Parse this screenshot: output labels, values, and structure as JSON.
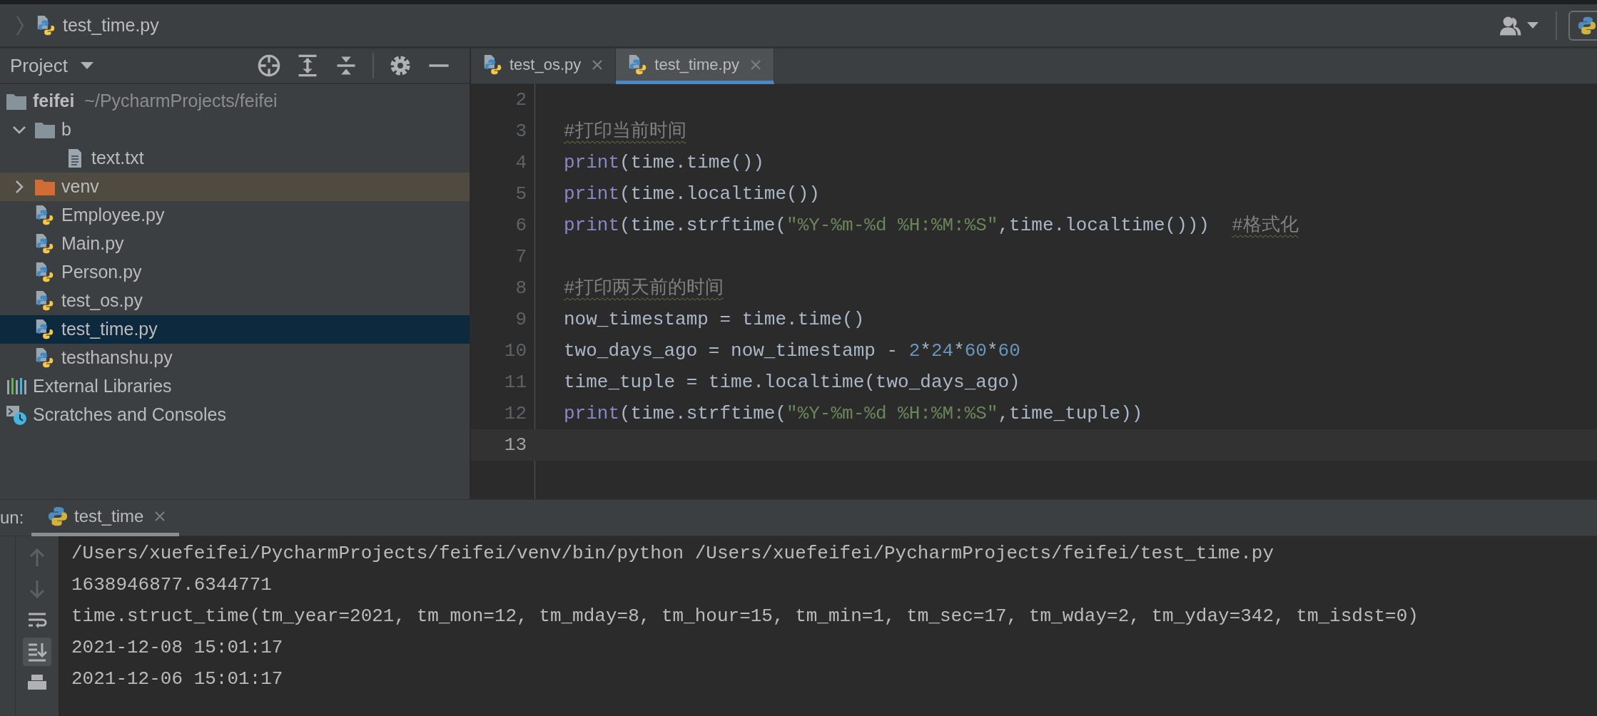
{
  "breadcrumb": {
    "file": "test_time.py"
  },
  "project_panel": {
    "title": "Project",
    "tree": [
      {
        "kind": "folder",
        "label": "feifei",
        "detail": "~/PycharmProjects/feifei",
        "selected": false,
        "children": [
          {
            "kind": "folder",
            "label": "b",
            "expanded": true,
            "selected": false,
            "children": [
              {
                "kind": "text-file",
                "label": "text.txt",
                "selected": false
              }
            ]
          },
          {
            "kind": "excluded-folder",
            "label": "venv",
            "expanded": false,
            "selected": false
          },
          {
            "kind": "python-file",
            "label": "Employee.py",
            "selected": false
          },
          {
            "kind": "python-file",
            "label": "Main.py",
            "selected": false
          },
          {
            "kind": "python-file",
            "label": "Person.py",
            "selected": false
          },
          {
            "kind": "python-file",
            "label": "test_os.py",
            "selected": false
          },
          {
            "kind": "python-file",
            "label": "test_time.py",
            "selected": true
          },
          {
            "kind": "python-file",
            "label": "testhanshu.py",
            "selected": false
          }
        ]
      },
      {
        "kind": "libraries",
        "label": "External Libraries",
        "selected": false
      },
      {
        "kind": "scratches",
        "label": "Scratches and Consoles",
        "selected": false
      }
    ]
  },
  "editor": {
    "tabs": [
      {
        "label": "test_os.py",
        "selected": false
      },
      {
        "label": "test_time.py",
        "selected": true
      }
    ],
    "lines": [
      {
        "number": "2",
        "current": false
      },
      {
        "number": "3",
        "current": false,
        "tokens": [
          {
            "kind": "comment",
            "text": "#打印当前时间"
          }
        ]
      },
      {
        "number": "4",
        "current": false,
        "tokens": [
          {
            "kind": "builtin",
            "text": "print"
          },
          {
            "kind": "plain",
            "text": "(time.time())"
          }
        ]
      },
      {
        "number": "5",
        "current": false,
        "tokens": [
          {
            "kind": "builtin",
            "text": "print"
          },
          {
            "kind": "plain",
            "text": "(time.localtime())"
          }
        ]
      },
      {
        "number": "6",
        "current": false,
        "tokens": [
          {
            "kind": "builtin",
            "text": "print"
          },
          {
            "kind": "plain",
            "text": "(time.strftime("
          },
          {
            "kind": "string",
            "text": "\"%Y-%m-%d %H:%M:%S\""
          },
          {
            "kind": "plain",
            "text": ",time.localtime()))  "
          },
          {
            "kind": "comment",
            "text": "#格式化"
          }
        ]
      },
      {
        "number": "7",
        "current": false
      },
      {
        "number": "8",
        "current": false,
        "tokens": [
          {
            "kind": "comment",
            "text": "#打印两天前的时间"
          }
        ]
      },
      {
        "number": "9",
        "current": false,
        "tokens": [
          {
            "kind": "plain",
            "text": "now_timestamp = time.time()"
          }
        ]
      },
      {
        "number": "10",
        "current": false,
        "tokens": [
          {
            "kind": "plain",
            "text": "two_days_ago = now_timestamp - "
          },
          {
            "kind": "number",
            "text": "2"
          },
          {
            "kind": "plain",
            "text": "*"
          },
          {
            "kind": "number",
            "text": "24"
          },
          {
            "kind": "plain",
            "text": "*"
          },
          {
            "kind": "number",
            "text": "60"
          },
          {
            "kind": "plain",
            "text": "*"
          },
          {
            "kind": "number",
            "text": "60"
          }
        ]
      },
      {
        "number": "11",
        "current": false,
        "tokens": [
          {
            "kind": "plain",
            "text": "time_tuple = time.localtime(two_days_ago)"
          }
        ]
      },
      {
        "number": "12",
        "current": false,
        "tokens": [
          {
            "kind": "builtin",
            "text": "print"
          },
          {
            "kind": "plain",
            "text": "(time.strftime("
          },
          {
            "kind": "string",
            "text": "\"%Y-%m-%d %H:%M:%S\""
          },
          {
            "kind": "plain",
            "text": ",time_tuple))"
          }
        ]
      },
      {
        "number": "13",
        "current": true
      }
    ]
  },
  "run_panel": {
    "label": "un:",
    "tabs": [
      {
        "label": "test_time",
        "selected": true
      }
    ],
    "toolbar": [
      {
        "kind": "previous",
        "selected": false
      },
      {
        "kind": "next",
        "selected": false
      },
      {
        "kind": "soft-wrap",
        "selected": false
      },
      {
        "kind": "scroll-to-end",
        "selected": true
      },
      {
        "kind": "print",
        "selected": false
      }
    ],
    "output": [
      "/Users/xuefeifei/PycharmProjects/feifei/venv/bin/python /Users/xuefeifei/PycharmProjects/feifei/test_time.py",
      "1638946877.6344771",
      "time.struct_time(tm_year=2021, tm_mon=12, tm_mday=8, tm_hour=15, tm_min=1, tm_sec=17, tm_wday=2, tm_yday=342, tm_isdst=0)",
      "2021-12-08 15:01:17",
      "2021-12-06 15:01:17"
    ]
  }
}
